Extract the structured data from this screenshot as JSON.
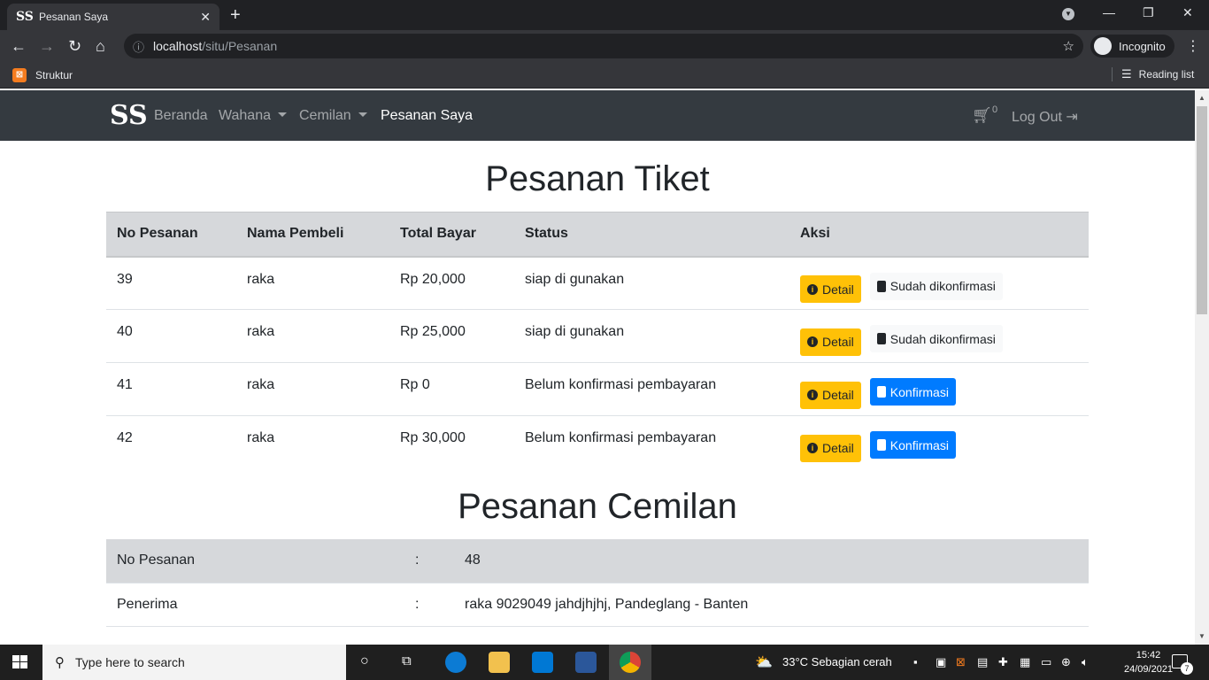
{
  "browser": {
    "tab_title": "Pesanan Saya",
    "favicon": "SS",
    "url_host": "localhost",
    "url_path": "/situ/Pesanan",
    "incognito_label": "Incognito",
    "bookmark": "Struktur",
    "reading_list": "Reading list"
  },
  "navbar": {
    "brand": "SS",
    "links": [
      "Beranda",
      "Wahana",
      "Cemilan",
      "Pesanan Saya"
    ],
    "cart_count": "0",
    "logout": "Log Out"
  },
  "tickets": {
    "title": "Pesanan Tiket",
    "headers": [
      "No Pesanan",
      "Nama Pembeli",
      "Total Bayar",
      "Status",
      "Aksi"
    ],
    "rows": [
      {
        "no": "39",
        "name": "raka",
        "total": "Rp 20,000",
        "status": "siap di gunakan",
        "detail": "Detail",
        "action": "Sudah dikonfirmasi"
      },
      {
        "no": "40",
        "name": "raka",
        "total": "Rp 25,000",
        "status": "siap di gunakan",
        "detail": "Detail",
        "action": "Sudah dikonfirmasi"
      },
      {
        "no": "41",
        "name": "raka",
        "total": "Rp 0",
        "status": "Belum konfirmasi pembayaran",
        "detail": "Detail",
        "action": "Konfirmasi"
      },
      {
        "no": "42",
        "name": "raka",
        "total": "Rp 30,000",
        "status": "Belum konfirmasi pembayaran",
        "detail": "Detail",
        "action": "Konfirmasi"
      }
    ]
  },
  "snacks": {
    "title": "Pesanan Cemilan",
    "rows": [
      {
        "label": "No Pesanan",
        "sep": ":",
        "value": "48"
      },
      {
        "label": "Penerima",
        "sep": ":",
        "value": "raka 9029049 jahdjhjhj, Pandeglang - Banten"
      }
    ]
  },
  "taskbar": {
    "search_placeholder": "Type here to search",
    "weather": "33°C  Sebagian cerah",
    "time": "15:42",
    "date": "24/09/2021",
    "notifications": "7"
  }
}
